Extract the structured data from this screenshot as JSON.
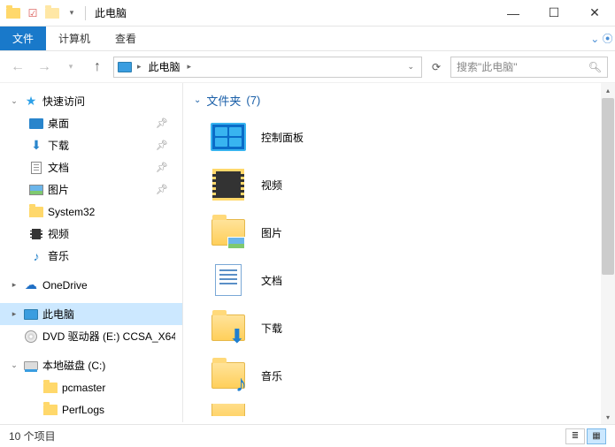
{
  "window": {
    "title": "此电脑"
  },
  "ribbon": {
    "file": "文件",
    "tabs": [
      "计算机",
      "查看"
    ]
  },
  "address": {
    "location": "此电脑",
    "search_placeholder": "搜索\"此电脑\""
  },
  "sidebar": {
    "quick": {
      "label": "快速访问"
    },
    "items": [
      {
        "label": "桌面",
        "pinned": true
      },
      {
        "label": "下载",
        "pinned": true
      },
      {
        "label": "文档",
        "pinned": true
      },
      {
        "label": "图片",
        "pinned": true
      },
      {
        "label": "System32",
        "pinned": false
      },
      {
        "label": "视频",
        "pinned": false
      },
      {
        "label": "音乐",
        "pinned": false
      }
    ],
    "onedrive": "OneDrive",
    "thispc": "此电脑",
    "dvd": "DVD 驱动器 (E:) CCSA_X64",
    "localdisk": "本地磁盘 (C:)",
    "folders": [
      "pcmaster",
      "PerfLogs"
    ]
  },
  "content": {
    "group": {
      "label": "文件夹",
      "count": "(7)"
    },
    "items": [
      {
        "label": "控制面板",
        "kind": "cpanel"
      },
      {
        "label": "视频",
        "kind": "video"
      },
      {
        "label": "图片",
        "kind": "pictures"
      },
      {
        "label": "文档",
        "kind": "documents"
      },
      {
        "label": "下载",
        "kind": "downloads"
      },
      {
        "label": "音乐",
        "kind": "music"
      }
    ]
  },
  "status": {
    "count": "10 个项目"
  }
}
